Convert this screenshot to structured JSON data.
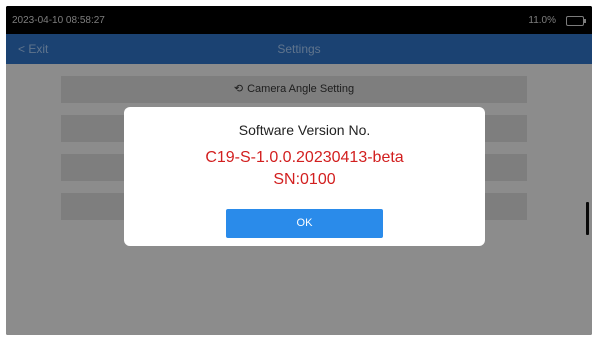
{
  "status_bar": {
    "datetime": "2023-04-10 08:58:27",
    "battery_text": "11.0%",
    "battery_icon": "battery-icon"
  },
  "title_bar": {
    "back_label": "< Exit",
    "title": "Settings"
  },
  "menu": {
    "items": [
      {
        "label": "Camera Angle Setting",
        "icon": "rotate-icon"
      },
      {
        "label": ""
      },
      {
        "label": ""
      },
      {
        "label": ""
      }
    ]
  },
  "dialog": {
    "title": "Software Version No.",
    "version": "C19-S-1.0.0.20230413-beta",
    "serial": "SN:0100",
    "ok_label": "OK",
    "accent_color": "#2a8bea",
    "text_highlight_color": "#d21f1f"
  }
}
